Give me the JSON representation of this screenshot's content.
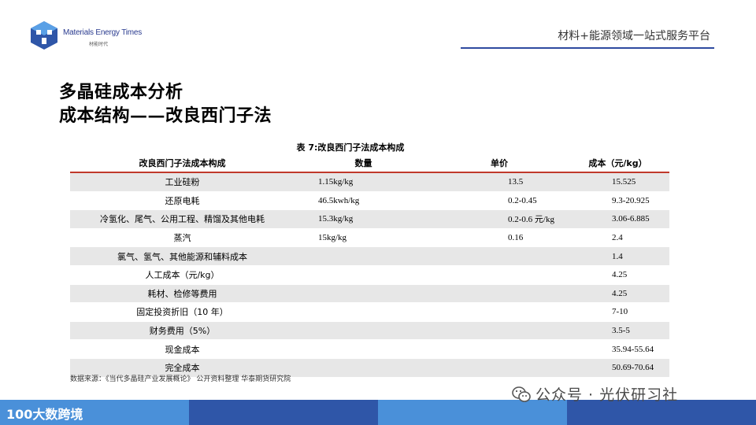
{
  "header": {
    "brand_name": "Materials Energy Times",
    "brand_sub": "材能时代",
    "tagline": "材料+能源领域一站式服务平台"
  },
  "title": {
    "line1": "多晶硅成本分析",
    "line2": "成本结构——改良西门子法"
  },
  "table": {
    "caption": "表 7:改良西门子法成本构成",
    "headers": [
      "改良西门子法成本构成",
      "数量",
      "单价",
      "成本（元/kg）"
    ],
    "rows": [
      [
        "工业硅粉",
        "1.15kg/kg",
        "13.5",
        "15.525"
      ],
      [
        "还原电耗",
        "46.5kwh/kg",
        "0.2-0.45",
        "9.3-20.925"
      ],
      [
        "冷氢化、尾气、公用工程、精馏及其他电耗",
        "15.3kg/kg",
        "0.2-0.6 元/kg",
        "3.06-6.885"
      ],
      [
        "蒸汽",
        "15kg/kg",
        "0.16",
        "2.4"
      ],
      [
        "氯气、氢气、其他能源和辅料成本",
        "",
        "",
        "1.4"
      ],
      [
        "人工成本（元/kg）",
        "",
        "",
        "4.25"
      ],
      [
        "耗材、检修等费用",
        "",
        "",
        "4.25"
      ],
      [
        "固定投资折旧（10 年）",
        "",
        "",
        "7-10"
      ],
      [
        "财务费用（5%）",
        "",
        "",
        "3.5-5"
      ],
      [
        "现金成本",
        "",
        "",
        "35.94-55.64"
      ],
      [
        "完全成本",
        "",
        "",
        "50.69-70.64"
      ]
    ]
  },
  "source": "数据来源：《当代多晶硅产业发展概论》 公开资料整理 华泰期货研究院",
  "watermark": "公众号 · 光伏研习社",
  "footer": {
    "brand": "100大数跨境"
  },
  "colors": {
    "accent_blue": "#2f56a8",
    "light_blue": "#4a90d9",
    "table_rule": "#c0392b",
    "row_shade": "#e7e7e7"
  },
  "icons": [
    "logo-cube-icon",
    "wechat-icon"
  ]
}
